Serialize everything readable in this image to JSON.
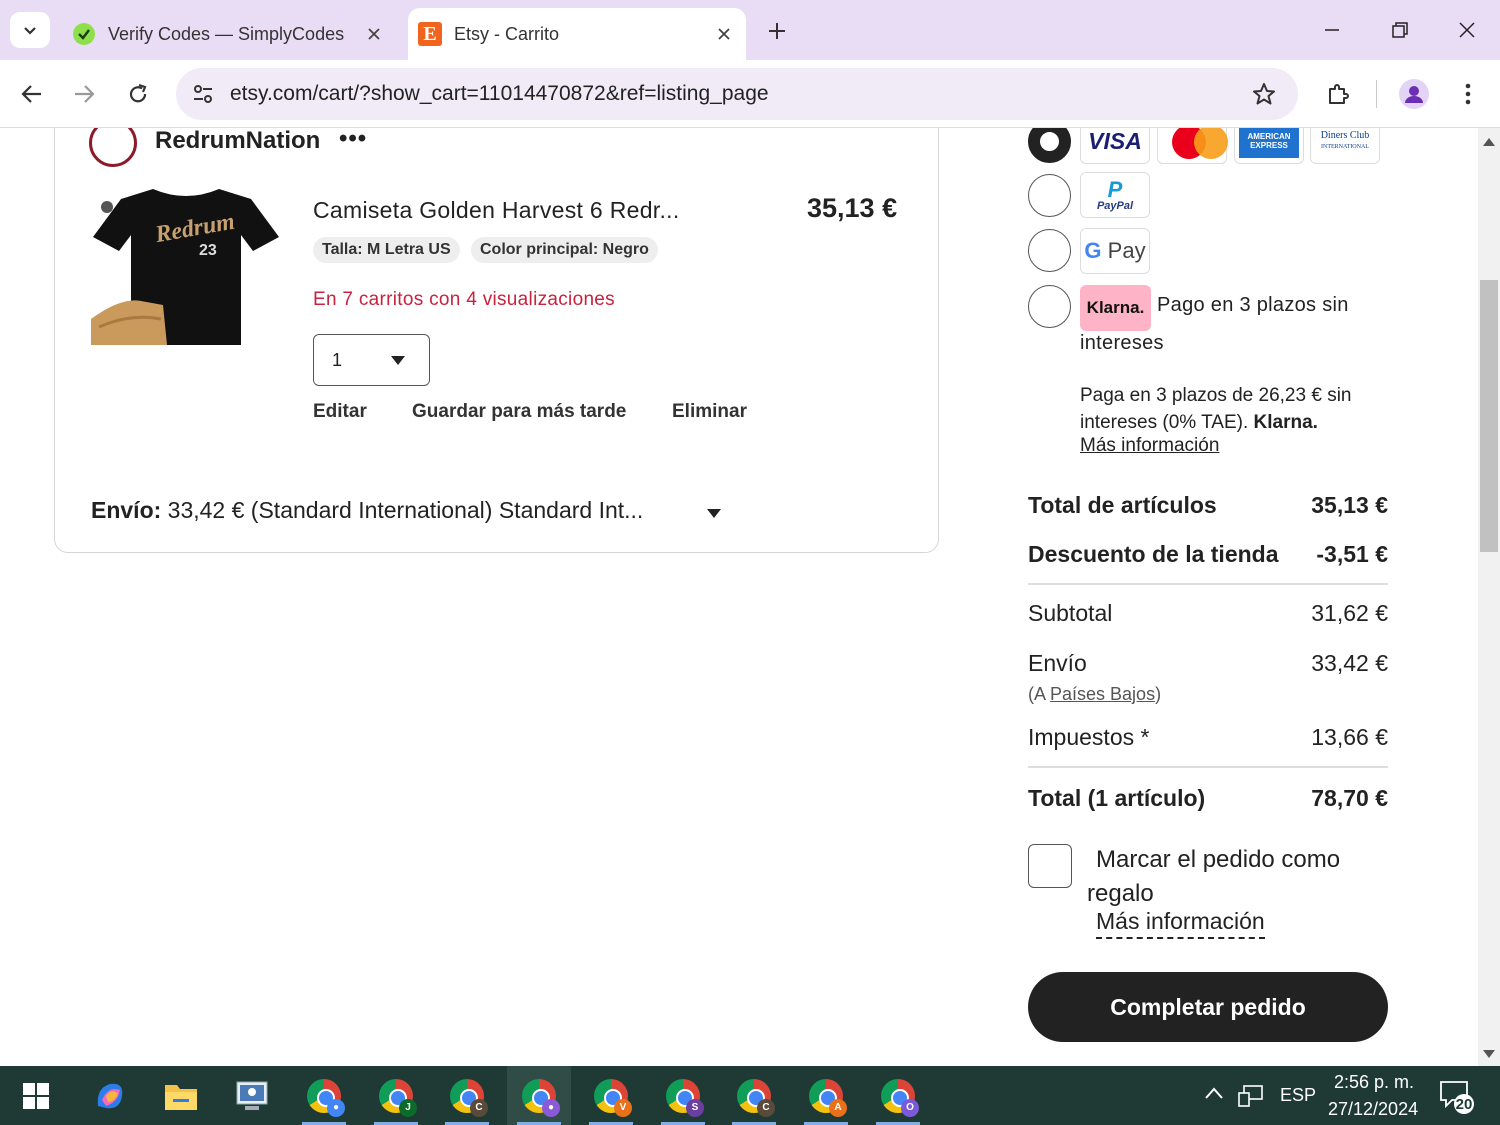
{
  "browser": {
    "tabs": [
      {
        "title": "Verify Codes — SimplyCodes",
        "active": false,
        "icon": "simplycodes-icon"
      },
      {
        "title": "Etsy - Carrito",
        "active": true,
        "icon": "etsy-icon",
        "icon_letter": "E"
      }
    ],
    "url": "etsy.com/cart/?show_cart=11014470872&ref=listing_page"
  },
  "shop": {
    "name": "RedrumNation",
    "more": "•••"
  },
  "item": {
    "title": "Camiseta Golden Harvest 6 Redr...",
    "price": "35,13 €",
    "chips": [
      "Talla: M Letra US",
      "Color principal: Negro"
    ],
    "alert": "En 7 carritos con 4 visualizaciones",
    "quantity": "1",
    "actions": {
      "edit": "Editar",
      "save": "Guardar para más tarde",
      "remove": "Eliminar"
    },
    "image_text": {
      "script": "Redrum",
      "number": "23"
    }
  },
  "shipping": {
    "label": "Envío:",
    "value": "33,42 € (Standard International) Standard Int..."
  },
  "payment": {
    "methods": [
      "VISA",
      "Mastercard",
      "American Express",
      "Diners Club",
      "PayPal",
      "G Pay",
      "Klarna"
    ],
    "card_labels": {
      "visa": "VISA",
      "amex": "AMERICAN EXPRESS",
      "diners": "Diners Club",
      "diners_sub": "INTERNATIONAL",
      "paypal": "PayPal",
      "gpay_g": "G",
      "gpay_text": "Pay",
      "klarna": "Klarna."
    },
    "klarna_title_line1": "Pago en 3 plazos sin",
    "klarna_title_line2": "intereses",
    "klarna_desc": "Paga en 3 plazos de 26,23 € sin intereses (0% TAE).",
    "klarna_brand": "Klarna.",
    "klarna_more": "Más información"
  },
  "summary": {
    "items_total_label": "Total de artículos",
    "items_total": "35,13 €",
    "discount_label": "Descuento de la tienda",
    "discount": "-3,51 €",
    "subtotal_label": "Subtotal",
    "subtotal": "31,62 €",
    "shipping_label": "Envío",
    "shipping": "33,42 €",
    "shipping_dest_prefix": "(A ",
    "shipping_dest": "Países Bajos",
    "shipping_dest_suffix": ")",
    "taxes_label": "Impuestos *",
    "taxes": "13,66 €",
    "total_label": "Total (1 artículo)",
    "total": "78,70 €"
  },
  "gift": {
    "label": "Marcar el pedido como regalo",
    "more": "Más información"
  },
  "checkout_label": "Completar pedido",
  "taskbar": {
    "language": "ESP",
    "time": "2:56 p. m.",
    "date": "27/12/2024",
    "notifications": "20",
    "chrome_profiles": [
      "J",
      "C",
      "",
      "V",
      "S",
      "C",
      "A",
      "O"
    ]
  },
  "colors": {
    "accent_alert": "#c8223e",
    "tabstrip": "#e8ddf4",
    "klarna_pink": "#ffb3c7",
    "etsy_orange": "#f1641e",
    "checkout": "#222222"
  }
}
